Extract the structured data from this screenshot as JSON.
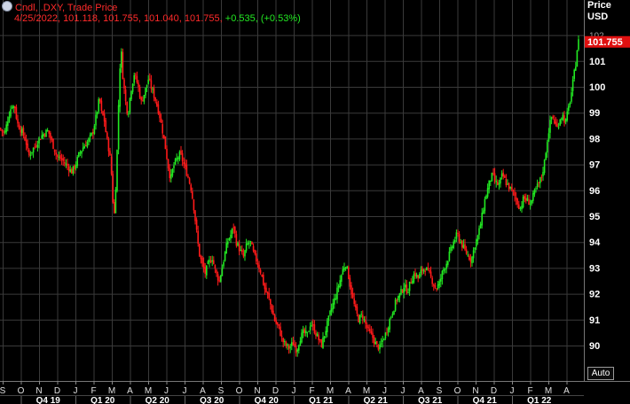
{
  "header": {
    "line1": "Cndl, .DXY, Trade Price",
    "date": "4/25/2022,",
    "ohlc": "101.118, 101.755, 101.040, 101.755,",
    "change": "+0.535, (+0.53%)"
  },
  "axis": {
    "title_line1": "Price",
    "title_line2": "USD",
    "auto_label": "Auto"
  },
  "colors": {
    "up": "#22e822",
    "down": "#ff1a1a",
    "grid": "#3a3a3a",
    "last_price_bg": "#e01010"
  },
  "chart_data": {
    "type": "candlestick",
    "title": "",
    "series_name": ".DXY",
    "y_ticks": [
      90,
      91,
      92,
      93,
      94,
      95,
      96,
      97,
      98,
      99,
      100,
      101,
      102
    ],
    "ylim": [
      89.4,
      102.2
    ],
    "last_price": "101.755",
    "month_labels": [
      "S",
      "O",
      "N",
      "D",
      "J",
      "F",
      "M",
      "A",
      "M",
      "J",
      "J",
      "A",
      "S",
      "O",
      "N",
      "D",
      "J",
      "F",
      "M",
      "A",
      "M",
      "J",
      "J",
      "A",
      "S",
      "O",
      "N",
      "D",
      "J",
      "F",
      "M",
      "A"
    ],
    "quarter_labels": [
      "Q4 19",
      "Q1 20",
      "Q2 20",
      "Q3 20",
      "Q4 20",
      "Q1 21",
      "Q2 21",
      "Q3 21",
      "Q4 21",
      "Q1 22"
    ],
    "price_path": [
      [
        0,
        98.4
      ],
      [
        6,
        98.2
      ],
      [
        10,
        98.8
      ],
      [
        14,
        99.3
      ],
      [
        18,
        99.2
      ],
      [
        20,
        98.6
      ],
      [
        25,
        98.3
      ],
      [
        30,
        97.9
      ],
      [
        33,
        97.3
      ],
      [
        36,
        97.5
      ],
      [
        40,
        97.7
      ],
      [
        45,
        98.0
      ],
      [
        50,
        98.2
      ],
      [
        55,
        98.3
      ],
      [
        60,
        97.8
      ],
      [
        65,
        97.3
      ],
      [
        70,
        97.2
      ],
      [
        75,
        97.0
      ],
      [
        78,
        96.9
      ],
      [
        81,
        96.7
      ],
      [
        85,
        96.9
      ],
      [
        90,
        97.4
      ],
      [
        95,
        97.7
      ],
      [
        100,
        97.9
      ],
      [
        105,
        98.2
      ],
      [
        110,
        99.0
      ],
      [
        113,
        99.6
      ],
      [
        115,
        99.0
      ],
      [
        118,
        98.8
      ],
      [
        121,
        98.0
      ],
      [
        124,
        97.5
      ],
      [
        126,
        96.9
      ],
      [
        128,
        95.6
      ],
      [
        129,
        94.7
      ],
      [
        131,
        96.0
      ],
      [
        133,
        97.7
      ],
      [
        135,
        100.0
      ],
      [
        137,
        101.6
      ],
      [
        139,
        100.5
      ],
      [
        142,
        99.5
      ],
      [
        145,
        98.9
      ],
      [
        148,
        99.8
      ],
      [
        152,
        100.5
      ],
      [
        156,
        100.1
      ],
      [
        160,
        99.4
      ],
      [
        164,
        99.8
      ],
      [
        168,
        100.3
      ],
      [
        172,
        99.9
      ],
      [
        176,
        99.5
      ],
      [
        180,
        99.0
      ],
      [
        184,
        98.3
      ],
      [
        187,
        97.7
      ],
      [
        190,
        97.0
      ],
      [
        193,
        96.4
      ],
      [
        196,
        96.9
      ],
      [
        200,
        97.2
      ],
      [
        204,
        97.4
      ],
      [
        208,
        97.0
      ],
      [
        212,
        96.6
      ],
      [
        216,
        96.1
      ],
      [
        219,
        95.4
      ],
      [
        222,
        94.5
      ],
      [
        225,
        93.6
      ],
      [
        228,
        93.2
      ],
      [
        232,
        92.8
      ],
      [
        236,
        93.2
      ],
      [
        240,
        93.4
      ],
      [
        244,
        92.8
      ],
      [
        248,
        92.5
      ],
      [
        251,
        93.0
      ],
      [
        254,
        93.5
      ],
      [
        257,
        94.0
      ],
      [
        261,
        94.3
      ],
      [
        264,
        94.6
      ],
      [
        267,
        94.0
      ],
      [
        271,
        93.7
      ],
      [
        275,
        93.4
      ],
      [
        279,
        93.9
      ],
      [
        283,
        94.0
      ],
      [
        287,
        93.5
      ],
      [
        291,
        93.2
      ],
      [
        295,
        92.8
      ],
      [
        299,
        92.2
      ],
      [
        303,
        91.9
      ],
      [
        307,
        91.4
      ],
      [
        311,
        90.9
      ],
      [
        315,
        90.7
      ],
      [
        319,
        90.2
      ],
      [
        323,
        90.0
      ],
      [
        327,
        89.9
      ],
      [
        331,
        90.1
      ],
      [
        335,
        89.8
      ],
      [
        339,
        90.3
      ],
      [
        343,
        90.5
      ],
      [
        347,
        90.4
      ],
      [
        351,
        90.9
      ],
      [
        355,
        90.6
      ],
      [
        359,
        90.3
      ],
      [
        363,
        90.0
      ],
      [
        367,
        90.5
      ],
      [
        371,
        91.0
      ],
      [
        375,
        91.5
      ],
      [
        379,
        91.9
      ],
      [
        383,
        92.4
      ],
      [
        387,
        92.9
      ],
      [
        390,
        93.2
      ],
      [
        393,
        92.8
      ],
      [
        396,
        92.2
      ],
      [
        399,
        91.7
      ],
      [
        402,
        91.3
      ],
      [
        405,
        91.0
      ],
      [
        409,
        91.2
      ],
      [
        413,
        90.8
      ],
      [
        417,
        90.5
      ],
      [
        421,
        90.3
      ],
      [
        425,
        90.0
      ],
      [
        429,
        89.9
      ],
      [
        432,
        90.2
      ],
      [
        436,
        90.5
      ],
      [
        440,
        91.0
      ],
      [
        444,
        91.4
      ],
      [
        448,
        91.8
      ],
      [
        452,
        92.0
      ],
      [
        456,
        92.3
      ],
      [
        460,
        92.1
      ],
      [
        464,
        92.5
      ],
      [
        468,
        92.8
      ],
      [
        472,
        92.6
      ],
      [
        476,
        92.9
      ],
      [
        480,
        93.0
      ],
      [
        484,
        92.8
      ],
      [
        488,
        92.5
      ],
      [
        492,
        92.2
      ],
      [
        496,
        92.4
      ],
      [
        500,
        92.9
      ],
      [
        504,
        93.2
      ],
      [
        508,
        93.6
      ],
      [
        512,
        94.0
      ],
      [
        516,
        94.3
      ],
      [
        520,
        94.0
      ],
      [
        524,
        93.7
      ],
      [
        528,
        93.5
      ],
      [
        532,
        93.3
      ],
      [
        536,
        93.9
      ],
      [
        540,
        94.3
      ],
      [
        544,
        95.0
      ],
      [
        547,
        95.6
      ],
      [
        550,
        96.0
      ],
      [
        553,
        96.4
      ],
      [
        556,
        96.6
      ],
      [
        559,
        96.3
      ],
      [
        563,
        96.2
      ],
      [
        567,
        96.6
      ],
      [
        571,
        96.3
      ],
      [
        575,
        96.1
      ],
      [
        579,
        95.9
      ],
      [
        583,
        95.6
      ],
      [
        587,
        95.3
      ],
      [
        591,
        95.7
      ],
      [
        595,
        95.6
      ],
      [
        599,
        95.5
      ],
      [
        603,
        95.9
      ],
      [
        607,
        96.2
      ],
      [
        611,
        96.5
      ],
      [
        614,
        97.0
      ],
      [
        617,
        97.8
      ],
      [
        620,
        98.5
      ],
      [
        623,
        98.9
      ],
      [
        626,
        98.6
      ],
      [
        629,
        98.4
      ],
      [
        632,
        98.8
      ],
      [
        635,
        98.9
      ],
      [
        638,
        98.6
      ],
      [
        641,
        99.1
      ],
      [
        644,
        99.6
      ],
      [
        647,
        100.3
      ],
      [
        650,
        101.0
      ],
      [
        652,
        101.755
      ]
    ]
  }
}
